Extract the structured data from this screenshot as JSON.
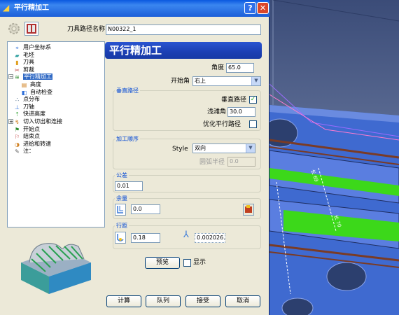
{
  "window": {
    "title": "平行精加工",
    "help_label": "?",
    "close_label": "✕"
  },
  "toolpath_name": {
    "label": "刀具路径名称",
    "value": "N00322_1"
  },
  "tree": {
    "items": [
      {
        "label": "用户坐标系",
        "icon": "ucs-icon"
      },
      {
        "label": "毛坯",
        "icon": "block-icon"
      },
      {
        "label": "刀具",
        "icon": "tool-icon"
      },
      {
        "label": "剪裁",
        "icon": "trim-icon"
      },
      {
        "label": "平行精加工",
        "icon": "raster-finish-icon"
      },
      {
        "label": "高度",
        "icon": "height-icon"
      },
      {
        "label": "自动检查",
        "icon": "auto-check-icon"
      },
      {
        "label": "点分布",
        "icon": "point-distribution-icon"
      },
      {
        "label": "刀轴",
        "icon": "tool-axis-icon"
      },
      {
        "label": "快进高度",
        "icon": "rapid-height-icon"
      },
      {
        "label": "切入切出和连接",
        "icon": "leads-links-icon"
      },
      {
        "label": "开始点",
        "icon": "start-point-icon"
      },
      {
        "label": "结束点",
        "icon": "end-point-icon"
      },
      {
        "label": "进给和转速",
        "icon": "feeds-speeds-icon"
      },
      {
        "label": "注：",
        "icon": "notes-icon"
      }
    ]
  },
  "header": {
    "title": "平行精加工"
  },
  "params": {
    "angle_label": "角度",
    "angle_value": "65.0",
    "start_corner_label": "开始角",
    "start_corner_value": "右上"
  },
  "vertical_path": {
    "group_title": "垂直路径",
    "vertical_label": "垂直路径",
    "vertical_checked": true,
    "shallow_angle_label": "浅滩角",
    "shallow_angle_value": "30.0",
    "optimize_label": "优化平行路径",
    "optimize_checked": false
  },
  "order": {
    "group_title": "加工顺序",
    "style_label": "Style",
    "style_value": "双向",
    "arc_radius_label": "圆弧半径",
    "arc_radius_value": "0.0"
  },
  "tolerance": {
    "group_title": "公差",
    "value": "0.01"
  },
  "allowance": {
    "group_title": "余量",
    "value": "0.0"
  },
  "stepover": {
    "group_title": "行距",
    "value": "0.18",
    "cusp_value": "0.002026."
  },
  "preview": {
    "button_label": "预览",
    "display_label": "显示",
    "display_checked": false
  },
  "footer": {
    "calculate_label": "计算",
    "queue_label": "队列",
    "accept_label": "接受",
    "cancel_label": "取消"
  },
  "viewport": {
    "dim_label_1": "长 69",
    "dim_label_2": "长 70"
  },
  "colors": {
    "title_bar": "#1b5ed8",
    "banner": "#1b3fb3",
    "accent_text": "#0046d5",
    "toolpath_green": "#33e000",
    "part_blue": "#3a64c8"
  }
}
